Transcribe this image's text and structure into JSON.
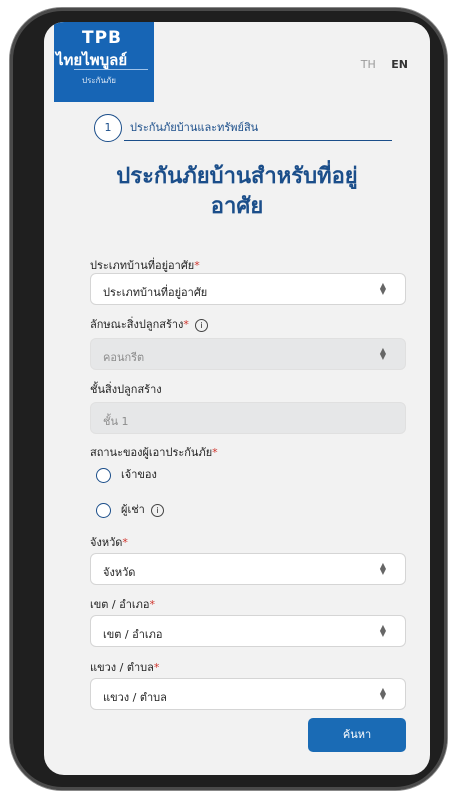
{
  "brand": {
    "name_top": "TPB",
    "name_thai": "ไทยไพบูลย์",
    "tagline": "ประกันภัย"
  },
  "lang": {
    "th": "TH",
    "en": "EN"
  },
  "step": {
    "number": "1",
    "label": "ประกันภัยบ้านและทรัพย์สิน"
  },
  "title_line1": "ประกันภัยบ้านสำหรับที่อยู่",
  "title_line2": "อาศัย",
  "required_mark": "*",
  "form": {
    "house_type": {
      "label": "ประเภทบ้านที่อยู่อาศัย",
      "value": "ประเภทบ้านที่อยู่อาศัย"
    },
    "construction": {
      "label": "ลักษณะสิ่งปลูกสร้าง",
      "value": "คอนกรีต"
    },
    "floor": {
      "label": "ชั้นสิ่งปลูกสร้าง",
      "value": "ชั้น 1"
    },
    "status": {
      "label": "สถานะของผู้เอาประกันภัย",
      "options": [
        "เจ้าของ",
        "ผู้เช่า"
      ]
    },
    "province": {
      "label": "จังหวัด",
      "value": "จังหวัด"
    },
    "district": {
      "label": "เขต / อำเภอ",
      "value": "เขต / อำเภอ"
    },
    "subdistrict": {
      "label": "แขวง / ตำบล",
      "value": "แขวง / ตำบล"
    }
  },
  "search_button": "ค้นหา",
  "icons": {
    "info": "i",
    "chevron": "up-down-chevron-icon"
  },
  "colors": {
    "primary": "#1b4e8a",
    "button": "#1a6bb5",
    "required": "#d0342c"
  }
}
